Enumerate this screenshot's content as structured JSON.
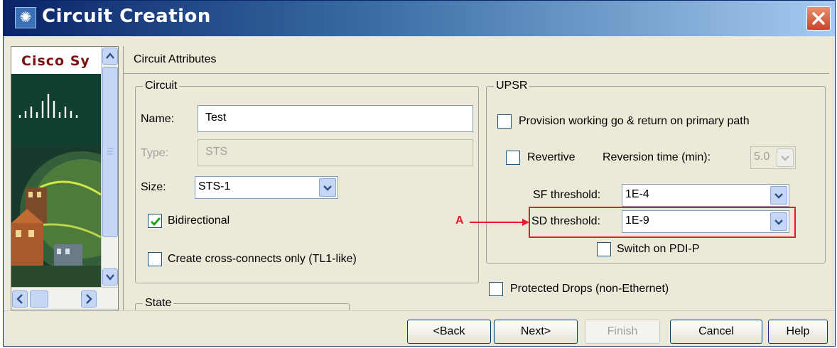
{
  "window": {
    "title": "Circuit Creation"
  },
  "logo": {
    "text": "Cisco Sy"
  },
  "main": {
    "section_title": "Circuit Attributes"
  },
  "circuit": {
    "group_label": "Circuit",
    "name_label": "Name:",
    "name_value": "Test",
    "type_label": "Type:",
    "type_value": "STS",
    "size_label": "Size:",
    "size_value": "STS-1",
    "bidirectional_label": "Bidirectional",
    "bidirectional_checked": true,
    "cross_connects_label": "Create cross-connects only (TL1-like)",
    "cross_connects_checked": false
  },
  "state": {
    "group_label": "State"
  },
  "upsr": {
    "group_label": "UPSR",
    "provision_label": "Provision working go & return on primary path",
    "revertive_label": "Revertive",
    "reversion_time_label": "Reversion time (min):",
    "reversion_time_value": "5.0",
    "sf_label": "SF threshold:",
    "sf_value": "1E-4",
    "sd_label": "SD threshold:",
    "sd_value": "1E-9",
    "switch_pdi_label": "Switch on PDI-P"
  },
  "protected_drops_label": "Protected Drops (non-Ethernet)",
  "annotation": {
    "marker": "A"
  },
  "buttons": {
    "back": "<Back",
    "next": "Next>",
    "finish": "Finish",
    "cancel": "Cancel",
    "help": "Help"
  }
}
